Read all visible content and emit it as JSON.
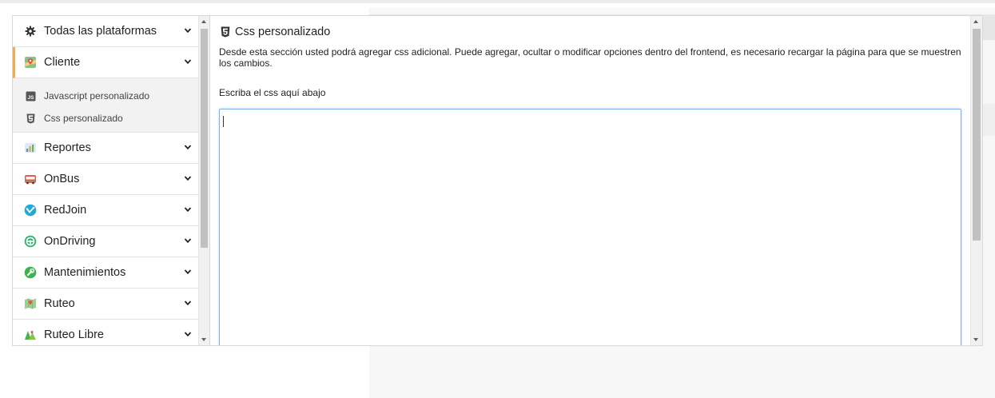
{
  "sidebar": {
    "items": [
      {
        "label": "Todas las plataformas",
        "icon": "gear-icon"
      },
      {
        "label": "Cliente",
        "icon": "client-map-icon",
        "active": true,
        "subitems": [
          {
            "label": "Javascript personalizado",
            "icon": "js-file-icon"
          },
          {
            "label": "Css personalizado",
            "icon": "css3-icon"
          }
        ]
      },
      {
        "label": "Reportes",
        "icon": "reports-chart-icon"
      },
      {
        "label": "OnBus",
        "icon": "bus-icon"
      },
      {
        "label": "RedJoin",
        "icon": "redjoin-icon"
      },
      {
        "label": "OnDriving",
        "icon": "ondriving-icon"
      },
      {
        "label": "Mantenimientos",
        "icon": "wrench-icon"
      },
      {
        "label": "Ruteo",
        "icon": "route-map-icon"
      },
      {
        "label": "Ruteo Libre",
        "icon": "free-route-icon"
      }
    ]
  },
  "main": {
    "title": "Css personalizado",
    "title_icon": "css3-icon",
    "description": "Desde esta sección usted podrá agregar css adicional. Puede agregar, ocultar o modificar opciones dentro del frontend, es necesario recargar la página para que se muestren los cambios.",
    "editor_label": "Escriba el css aquí abajo",
    "editor_value": ""
  },
  "colors": {
    "active_accent": "#f0ad4e",
    "editor_focus_border": "#7fb0e0"
  }
}
